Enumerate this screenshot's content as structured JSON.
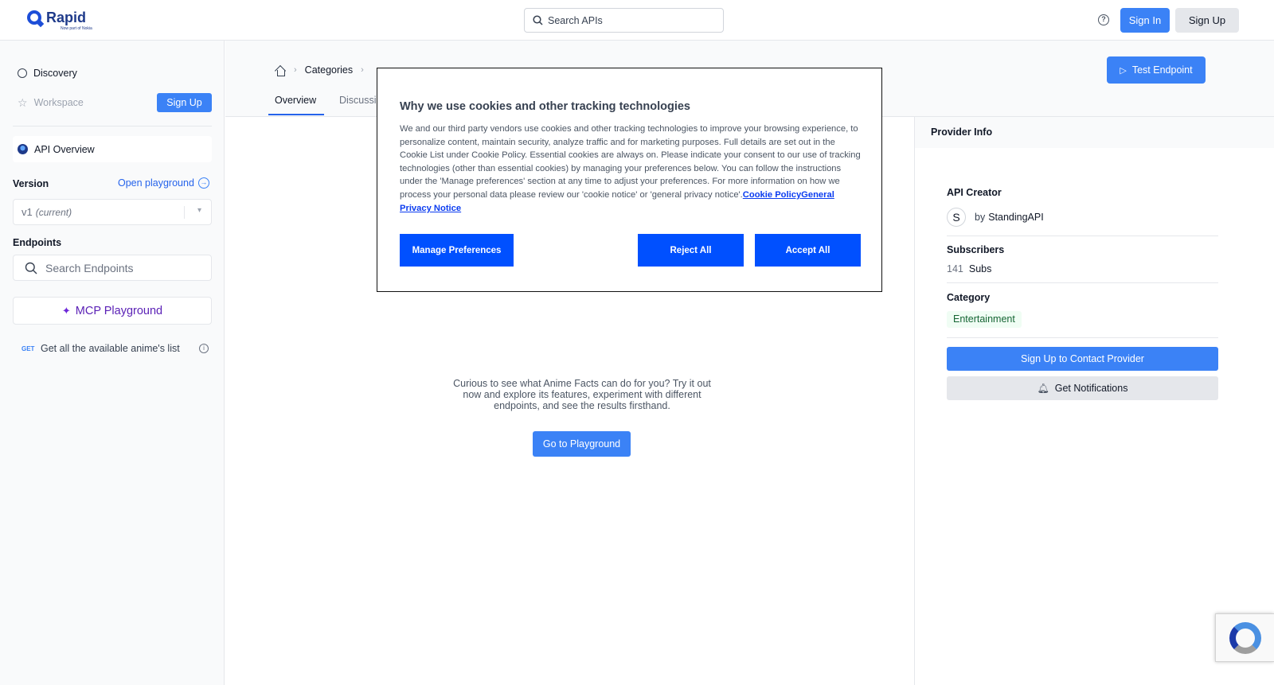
{
  "header": {
    "logo_word": "Rapid",
    "logo_sub": "Now part of Nokia",
    "search_placeholder": "Search APIs",
    "sign_in": "Sign In",
    "sign_up": "Sign Up"
  },
  "sidebar": {
    "discovery": "Discovery",
    "workspace": "Workspace",
    "sign_up": "Sign Up",
    "api_overview": "API Overview",
    "version_label": "Version",
    "open_playground": "Open playground",
    "version_value": "v1",
    "version_note": "(current)",
    "endpoints_label": "Endpoints",
    "search_endpoints_placeholder": "Search Endpoints",
    "mcp_playground": "MCP Playground",
    "endpoints": [
      {
        "method": "GET",
        "name": "Get all the available anime's list"
      }
    ]
  },
  "main": {
    "breadcrumb": [
      "Categories"
    ],
    "tabs": [
      {
        "label": "Overview",
        "active": true
      },
      {
        "label": "Discussi",
        "active": false
      }
    ],
    "test_endpoint": "Test Endpoint",
    "playground_blurb": "Curious to see what Anime Facts can do for you? Try it out now and explore its features, experiment with different endpoints, and see the results firsthand.",
    "go_to_playground": "Go to Playground"
  },
  "provider": {
    "heading": "Provider Info",
    "creator_label": "API Creator",
    "creator_initial": "S",
    "creator_by": "by",
    "creator_name": "StandingAPI",
    "subscribers_label": "Subscribers",
    "subscribers_count": "141",
    "subscribers_unit": "Subs",
    "category_label": "Category",
    "category_value": "Entertainment",
    "contact_button": "Sign Up to Contact Provider",
    "notify_button": "Get Notifications"
  },
  "cookie_banner": {
    "title": "Why we use cookies and other tracking technologies",
    "body": "We and our third party vendors use cookies and other tracking technologies to improve your browsing experience, to personalize content, maintain security, analyze traffic and for marketing purposes. Full details are set out in the Cookie List under Cookie Policy. Essential cookies are always on. Please indicate your consent to our use of tracking technologies (other than essential cookies) by managing your preferences below. You can follow the instructions under the 'Manage preferences' section at any time to adjust your preferences. For more information on how we process your personal data please review our 'cookie notice' or 'general privacy notice'.",
    "link_cookie_policy": "Cookie Policy",
    "link_privacy": "General Privacy Notice",
    "manage": "Manage Preferences",
    "reject": "Reject All",
    "accept": "Accept All"
  },
  "colors": {
    "primary": "#3b82f6",
    "cookie_button": "#0050ff",
    "mcp_purple": "#5b21b6"
  }
}
